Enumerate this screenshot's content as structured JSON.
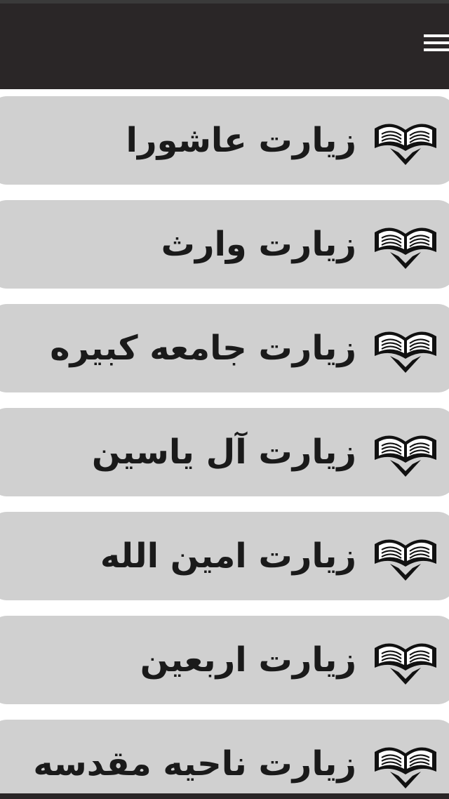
{
  "app_bar": {
    "menu_icon": "hamburger-menu-icon",
    "background_color": "#2a2627"
  },
  "list": {
    "item_background": "#d0d0d0",
    "item_icon": "open-quran-book-icon",
    "items": [
      {
        "label": "زیارت عاشورا"
      },
      {
        "label": "زیارت وارث"
      },
      {
        "label": "زیارت جامعه کبیره"
      },
      {
        "label": "زیارت آل یاسین"
      },
      {
        "label": "زیارت امین الله"
      },
      {
        "label": "زیارت اربعین"
      },
      {
        "label": "زیارت ناحیه مقدسه"
      }
    ]
  }
}
